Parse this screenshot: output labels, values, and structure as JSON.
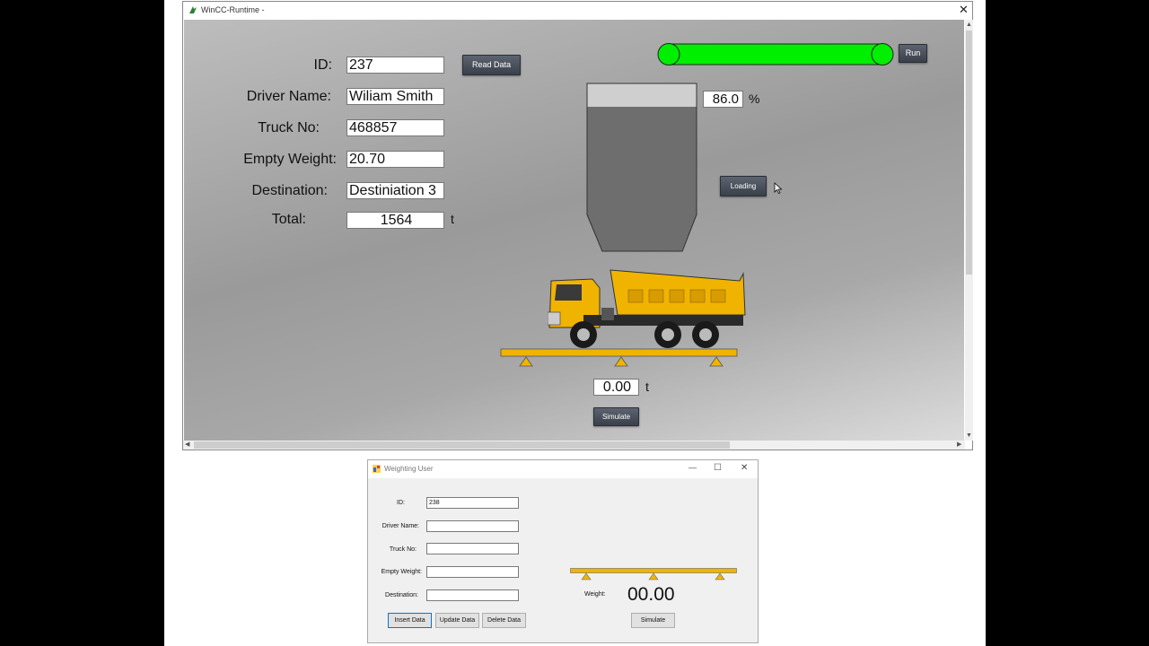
{
  "wincc": {
    "title": "WinCC-Runtime -",
    "close_glyph": "✕",
    "form": {
      "id_label": "ID:",
      "id_value": "237",
      "driver_label": "Driver Name:",
      "driver_value": "Wiliam Smith",
      "truck_label": "Truck No:",
      "truck_value": "468857",
      "empty_label": "Empty Weight:",
      "empty_value": "20.70",
      "dest_label": "Destination:",
      "dest_value": "Destiniation 3",
      "total_label": "Total:",
      "total_value": "1564",
      "total_unit": "t"
    },
    "read_button": "Read Data",
    "run_button": "Run",
    "conveyor_color": "#00ee00",
    "silo": {
      "level_value": "86.0",
      "unit": "%",
      "level_fraction": 0.86
    },
    "loading_button": "Loading",
    "scale_value": "0.00",
    "scale_unit": "t",
    "simulate_button": "Simulate",
    "truck_color": "#f0b400",
    "icons": [
      "wincc-app-icon",
      "close-icon",
      "scroll-up-arrow",
      "scroll-down-arrow",
      "scroll-left-arrow",
      "scroll-right-arrow",
      "mouse-cursor-icon",
      "truck-icon"
    ]
  },
  "weighting_user": {
    "title": "Weighting User",
    "window_controls": {
      "minimize": "—",
      "maximize": "☐",
      "close": "✕"
    },
    "id_label": "ID:",
    "id_value": "238",
    "driver_label": "Driver Name:",
    "driver_value": "",
    "truck_label": "Truck No:",
    "truck_value": "",
    "empty_label": "Empty Weight:",
    "empty_value": "",
    "dest_label": "Destination:",
    "dest_value": "",
    "insert_button": "Insert Data",
    "update_button": "Update Data",
    "delete_button": "Delete Data",
    "weight_label": "Weight:",
    "weight_value": "00.00",
    "simulate_button": "Simulate"
  }
}
